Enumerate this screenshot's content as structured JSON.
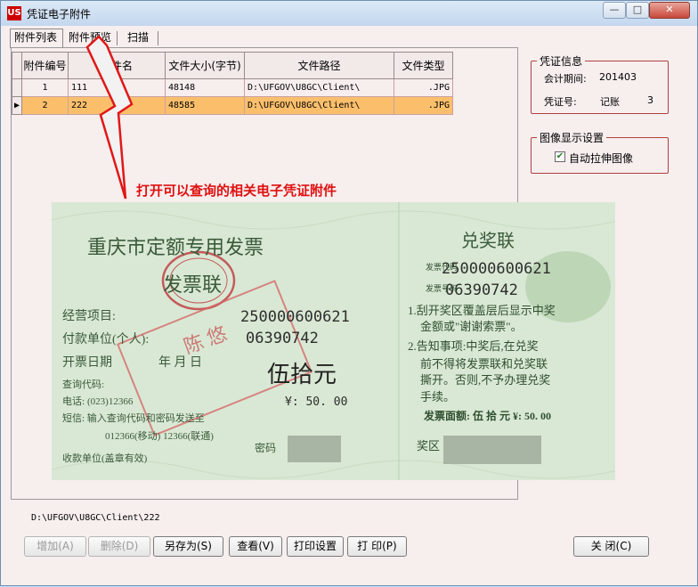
{
  "window": {
    "title": "凭证电子附件",
    "app_icon": "US",
    "buttons": {
      "minimize": "—",
      "maximize": "□",
      "close": "✕"
    }
  },
  "tabs": [
    "附件列表",
    "附件预览",
    "扫描"
  ],
  "table": {
    "columns": [
      "附件编号",
      "文件名",
      "文件大小(字节)",
      "文件路径",
      "文件类型"
    ],
    "rows": [
      {
        "id": "1",
        "name": "111",
        "size": "48148",
        "path": "D:\\UFGOV\\U8GC\\Client\\",
        "type": ".JPG",
        "selected": false
      },
      {
        "id": "2",
        "name": "222",
        "size": "48585",
        "path": "D:\\UFGOV\\U8GC\\Client\\",
        "type": ".JPG",
        "selected": true
      }
    ],
    "current_row_marker": "▶"
  },
  "voucher_info": {
    "legend": "凭证信息",
    "period_label": "会计期间:",
    "period_value": "201403",
    "voucher_label": "凭证号:",
    "voucher_type": "记账",
    "voucher_number": "3"
  },
  "display_settings": {
    "legend": "图像显示设置",
    "stretch_label": "自动拉伸图像",
    "stretch_checked": true
  },
  "annotation": "打开可以查询的相关电子凭证附件",
  "invoice": {
    "title": "重庆市定额专用发票",
    "stub_title": "兑奖联",
    "copy_name": "发票联",
    "fields": {
      "item_label": "经营项目:",
      "payer_label": "付款单位(个人):",
      "date_label": "开票日期",
      "date_units": "年  月  日",
      "query_code_label": "查询代码:",
      "phone_label": "电话:",
      "phone_value": "(023)12366",
      "sms_text": "短信: 输入查询代码和密码发送至",
      "sms_numbers": "012366(移动)  12366(联通)",
      "receiver_label": "收款单位(盖章有效)",
      "password_label": "密码"
    },
    "invoice_code": "250000600621",
    "invoice_number": "06390742",
    "amount_text": "伍拾元",
    "amount_number": "¥: 50. 00",
    "stub": {
      "code_label": "发票代码",
      "code_value": "250000600621",
      "number_label": "发票号码",
      "number_value": "06390742",
      "rule1": "1.刮开奖区覆盖层后显示中奖",
      "rule1b": "金额或\"谢谢索票\"。",
      "rule2": "2.告知事项:中奖后,在兑奖",
      "rule2b": "前不得将发票联和兑奖联",
      "rule2c": "撕开。否则,不予办理兑奖",
      "rule2d": "手续。",
      "face_value": "发票面额: 伍 拾 元  ¥: 50. 00",
      "prize_area": "奖区"
    },
    "stamp_text": "陈 悠"
  },
  "file_path": "D:\\UFGOV\\U8GC\\Client\\222",
  "buttons": {
    "add": "增加(A)",
    "delete": "删除(D)",
    "save_as": "另存为(S)",
    "view": "查看(V)",
    "print_setup": "打印设置",
    "print": "打 印(P)",
    "close": "关  闭(C)"
  },
  "colors": {
    "selected_row": "#fbbf6c",
    "annotation": "#e01010",
    "group_border": "#b04040",
    "invoice_background": "#d7e6d2"
  }
}
